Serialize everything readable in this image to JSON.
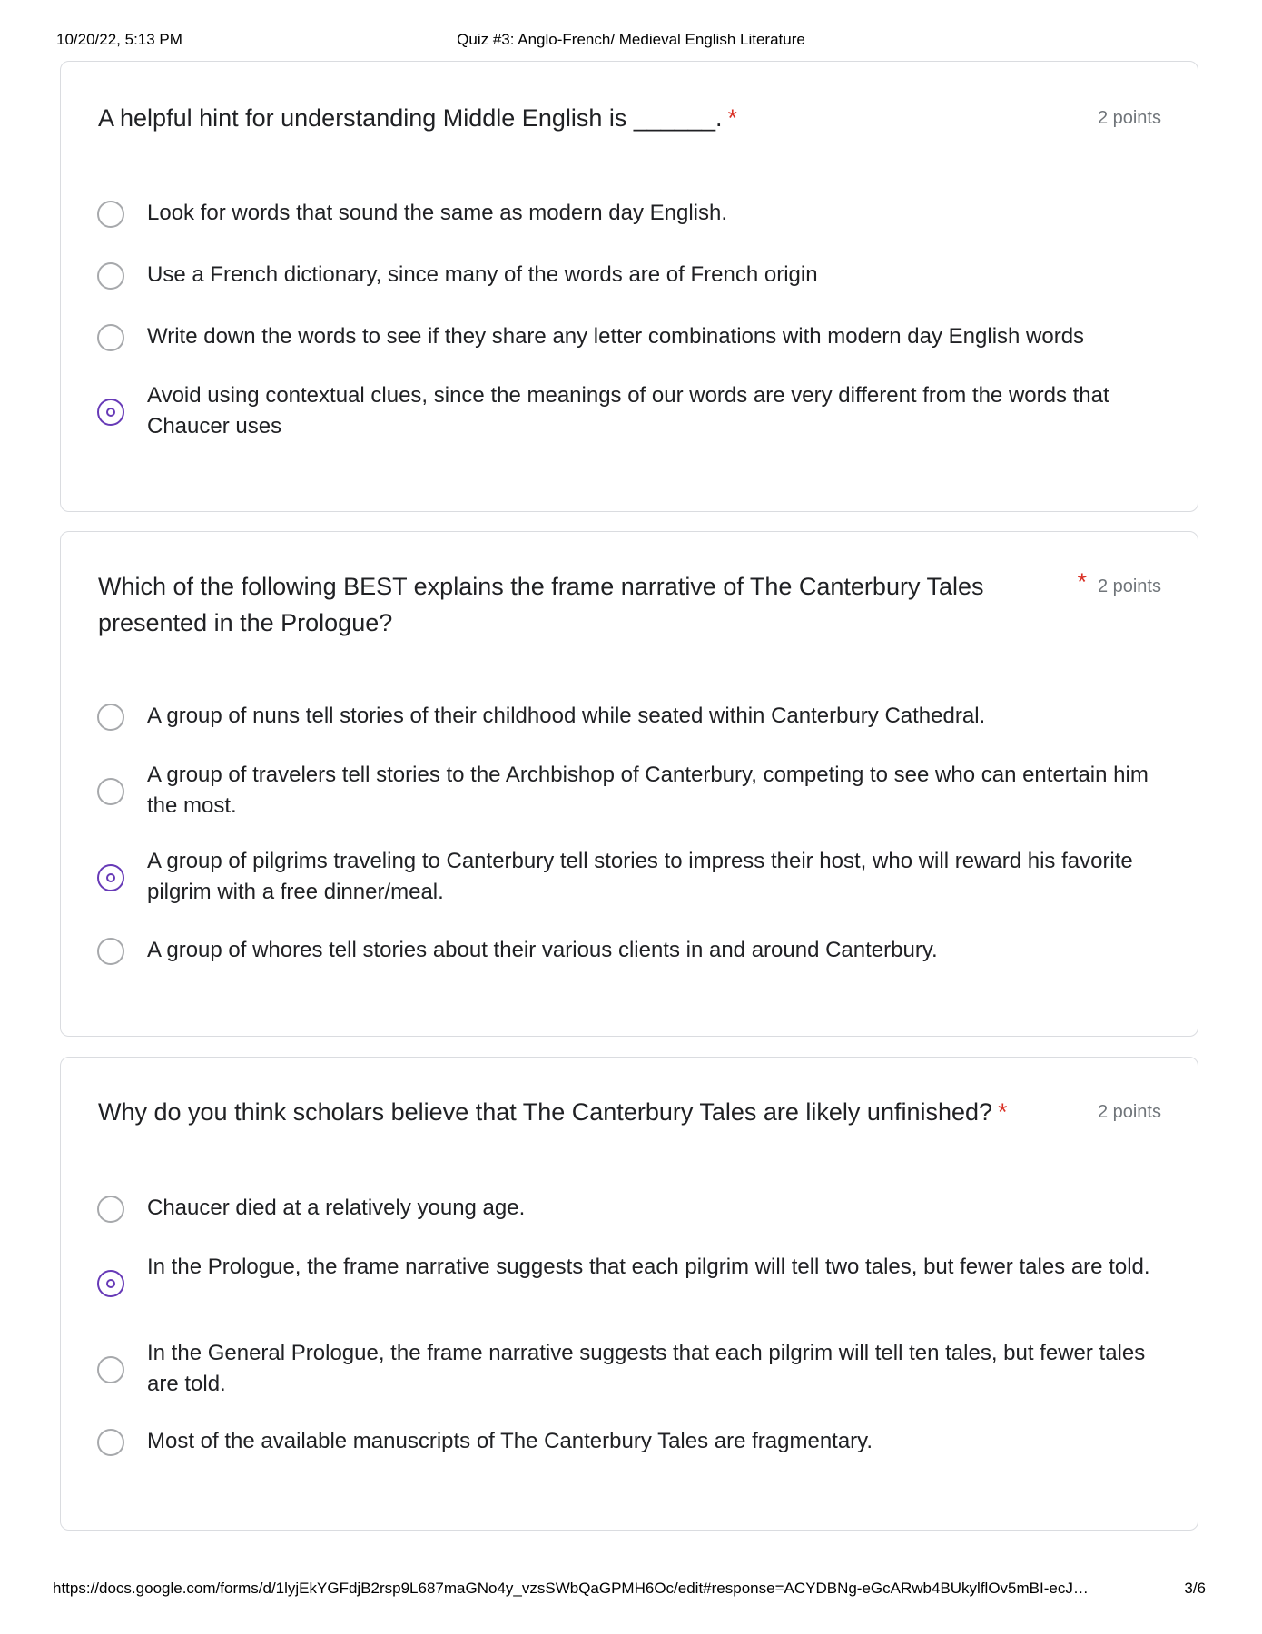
{
  "print_header": {
    "datetime": "10/20/22, 5:13 PM",
    "title": "Quiz #3: Anglo-French/ Medieval English Literature"
  },
  "print_footer": {
    "url": "https://docs.google.com/forms/d/1lyjEkYGFdjB2rsp9L687maGNo4y_vzsSWbQaGPMH6Oc/edit#response=ACYDBNg-eGcARwb4BUkylflOv5mBI-ecJ…",
    "page": "3/6"
  },
  "colors": {
    "required": "#d93025",
    "selected_radio": "#673ab7",
    "points": "#70757a"
  },
  "questions": [
    {
      "title": "A helpful hint for understanding Middle English is ______.",
      "required_marker": "*",
      "points": "2 points",
      "options": [
        {
          "label": "Look for words that sound the same as modern day English.",
          "selected": false
        },
        {
          "label": "Use a French dictionary, since many of the words are of French origin",
          "selected": false
        },
        {
          "label": "Write down the words to see if they share any letter combinations with modern day English words",
          "selected": false
        },
        {
          "label": "Avoid using contextual clues, since the meanings of our words are very different from the words that Chaucer uses",
          "selected": true
        }
      ]
    },
    {
      "title": "Which of the following BEST explains the frame narrative of The Canterbury Tales presented in the  Prologue?",
      "required_marker": "*",
      "points": "2 points",
      "options": [
        {
          "label": "A group of nuns tell stories of their childhood while seated within Canterbury Cathedral.",
          "selected": false
        },
        {
          "label": "A group of travelers tell stories to the Archbishop of Canterbury, competing to see who can entertain him the most.",
          "selected": false
        },
        {
          "label": "A group of pilgrims traveling to Canterbury tell stories to impress their host, who will reward his favorite pilgrim with a free dinner/meal.",
          "selected": true
        },
        {
          "label": "A group of whores tell stories about their various clients in and around Canterbury.",
          "selected": false
        }
      ]
    },
    {
      "title": "Why do you think scholars believe that The Canterbury Tales are likely unfinished?",
      "required_marker": "*",
      "points": "2 points",
      "options": [
        {
          "label": "Chaucer died at a relatively young age.",
          "selected": false
        },
        {
          "label": "In the Prologue, the frame narrative suggests that each pilgrim will tell two tales, but fewer tales are told.",
          "selected": true
        },
        {
          "label": "In the General Prologue, the frame narrative suggests that each pilgrim will tell ten tales, but fewer tales are told.",
          "selected": false
        },
        {
          "label": "Most of the available manuscripts of The Canterbury Tales are fragmentary.",
          "selected": false
        }
      ]
    }
  ]
}
